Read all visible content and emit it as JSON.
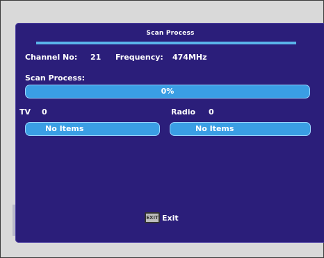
{
  "screen": {
    "title": "Scan Process",
    "channel_no_label": "Channel No:",
    "channel_no_value": "21",
    "frequency_label": "Frequency:",
    "frequency_value": "474MHz",
    "scan_process_label": "Scan Process:",
    "progress_text": "0%",
    "progress_percent": 0,
    "tv_label": "TV",
    "tv_count": "0",
    "tv_status": "No Items",
    "radio_label": "Radio",
    "radio_count": "0",
    "radio_status": "No Items",
    "exit_key_label": "EXIT",
    "exit_label": "Exit"
  },
  "colors": {
    "screen_background": "#2b1e7a",
    "bar_fill": "#3a9ee4",
    "title_underline": "#5ab4ea",
    "text": "#ffffff"
  }
}
